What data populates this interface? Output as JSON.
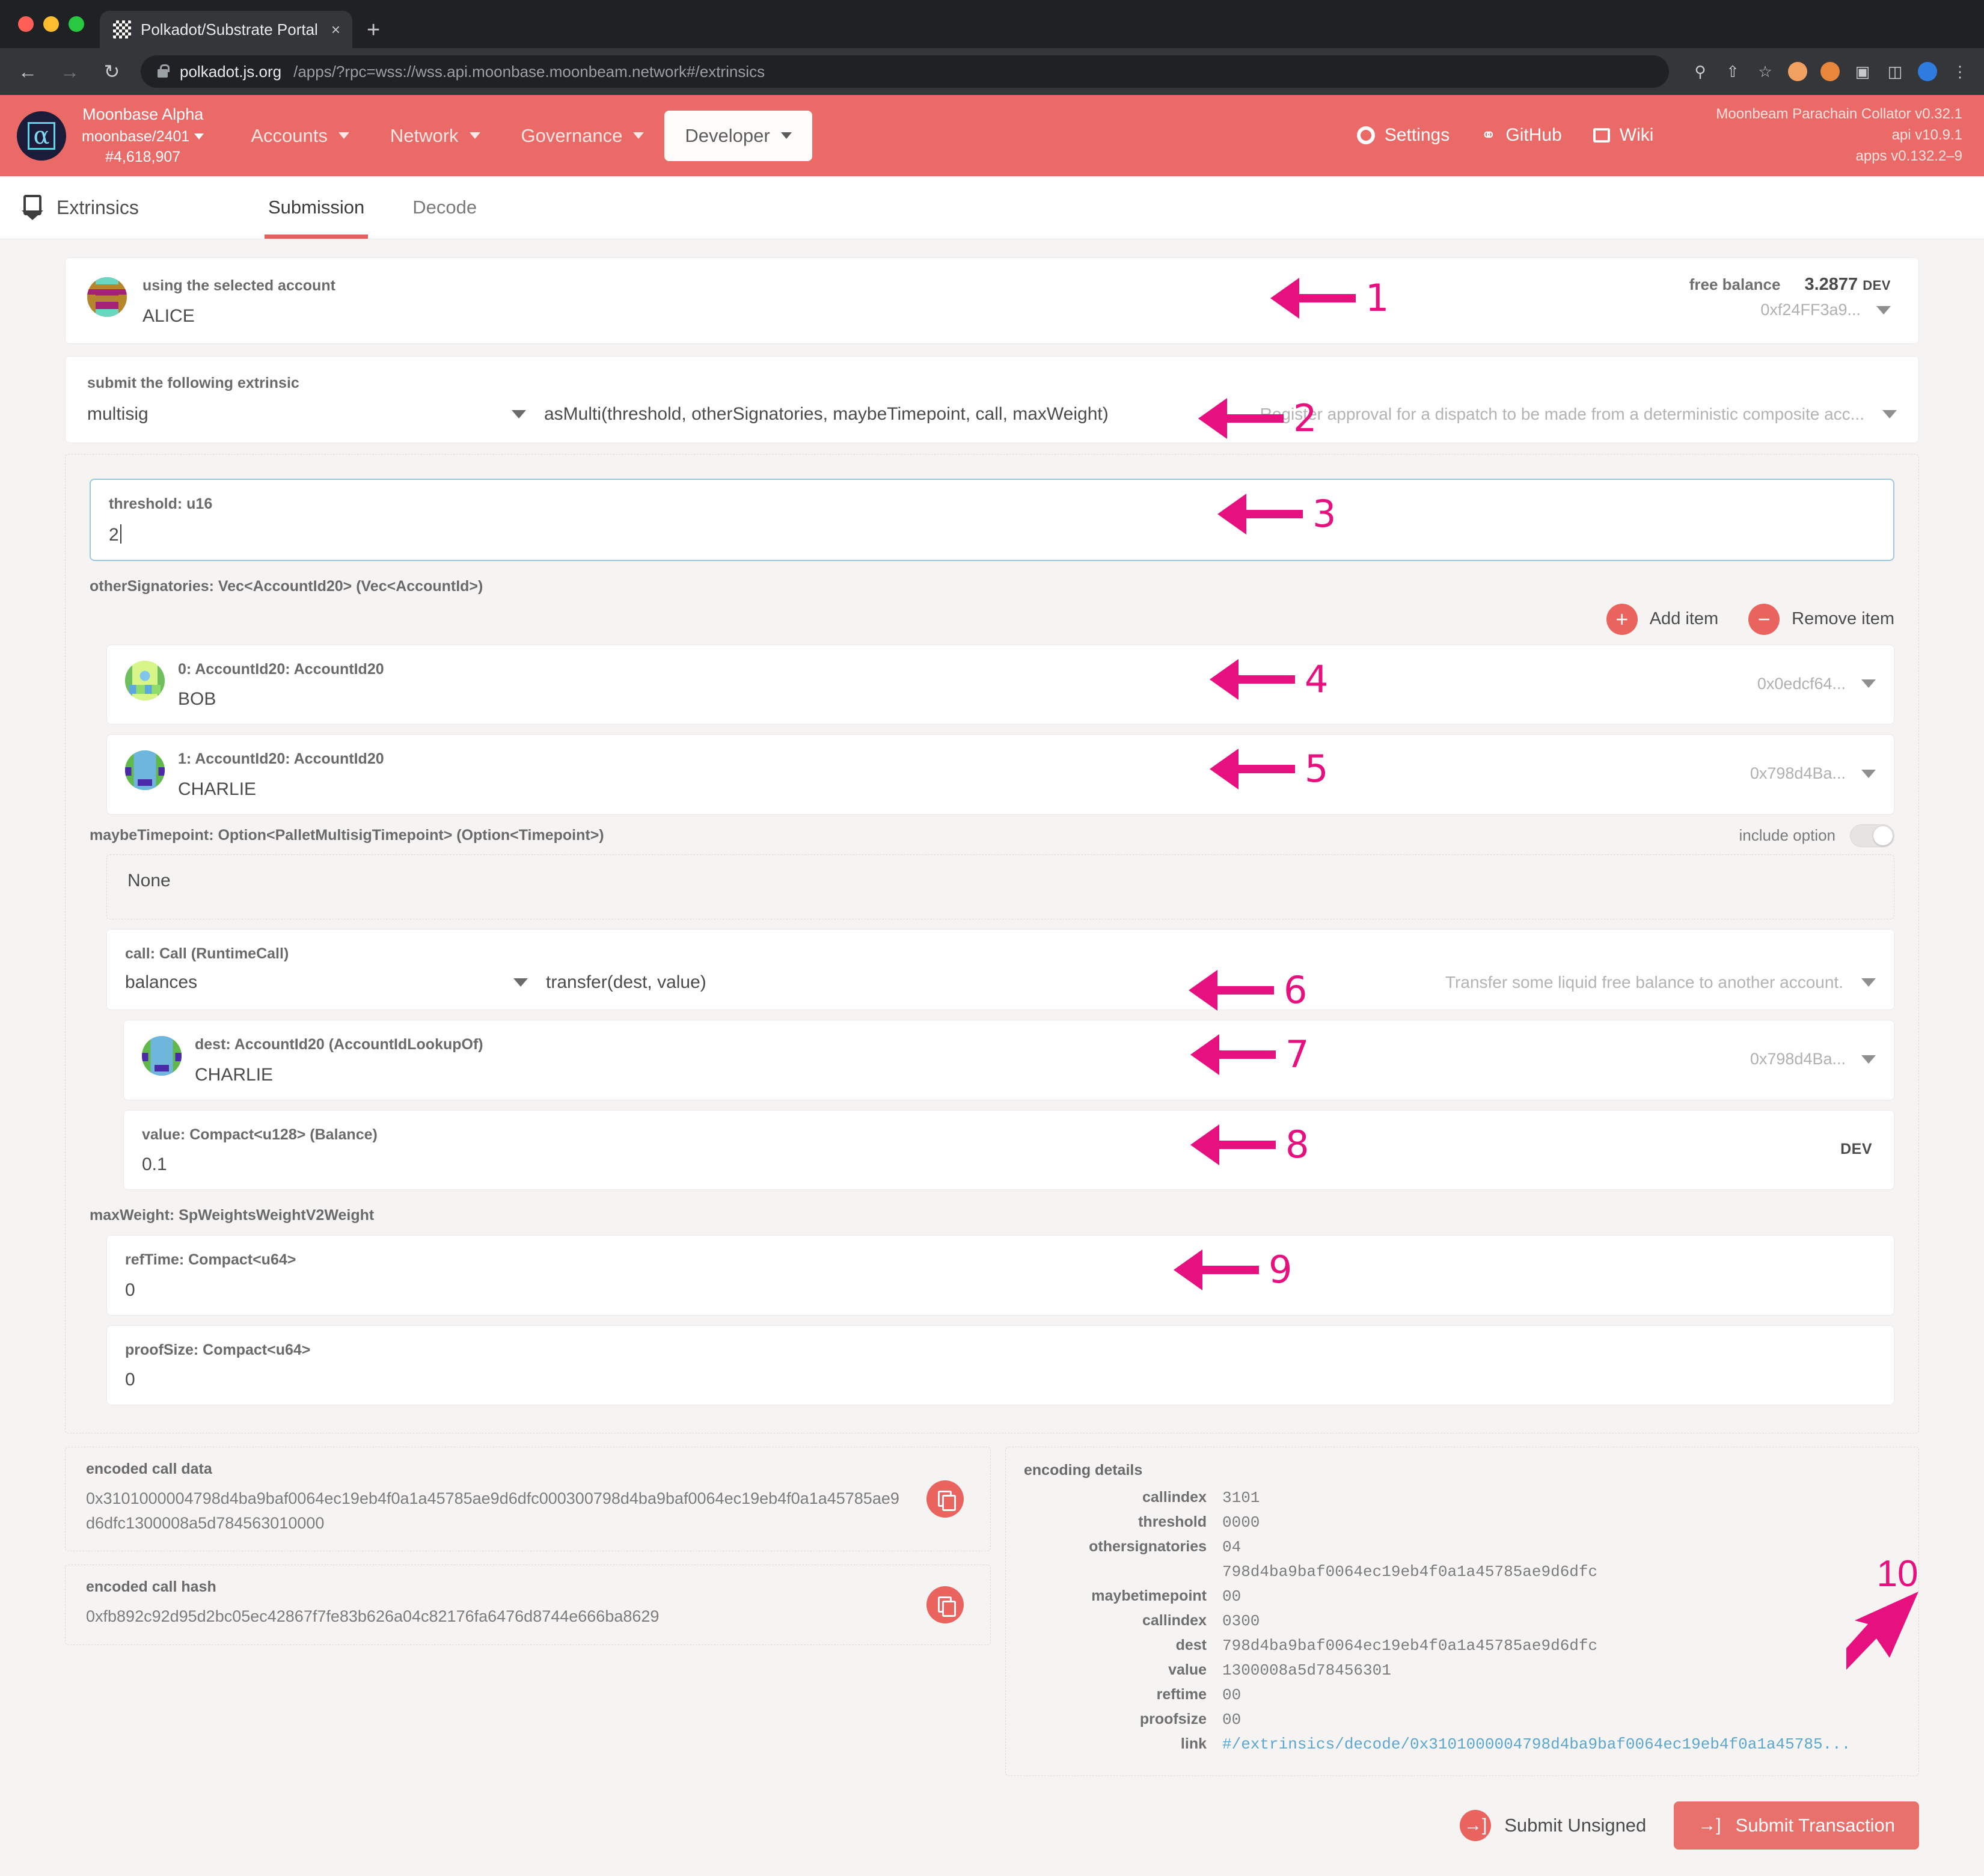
{
  "browser": {
    "tab_title": "Polkadot/Substrate Portal",
    "close_label": "×",
    "newtab_label": "+",
    "back_icon": "←",
    "forward_icon": "→",
    "reload_icon": "↻",
    "url_domain": "polkadot.js.org",
    "url_rest": "/apps/?rpc=wss://wss.api.moonbase.moonbeam.network#/extrinsics",
    "omni_icons": [
      "zoom-icon",
      "share-icon",
      "bookmark-icon",
      "extension-orange",
      "extension-fox",
      "puzzle-icon",
      "sidepanel-icon",
      "profile-icon",
      "menu-icon"
    ]
  },
  "appbar": {
    "chain_name": "Moonbase Alpha",
    "chain_spec": "moonbase/2401",
    "block_number": "#4,618,907",
    "nav": [
      {
        "label": "Accounts",
        "active": false
      },
      {
        "label": "Network",
        "active": false
      },
      {
        "label": "Governance",
        "active": false
      },
      {
        "label": "Developer",
        "active": true
      }
    ],
    "settings_label": "Settings",
    "github_label": "GitHub",
    "wiki_label": "Wiki",
    "version_node": "Moonbeam Parachain Collator v0.32.1",
    "version_api": "api v10.9.1",
    "version_apps": "apps v0.132.2–9",
    "accent": "#e96a66"
  },
  "subheader": {
    "breadcrumb": "Extrinsics",
    "tabs": [
      {
        "label": "Submission",
        "active": true
      },
      {
        "label": "Decode",
        "active": false
      }
    ]
  },
  "account": {
    "label": "using the selected account",
    "value": "ALICE",
    "balance_label": "free balance",
    "balance_amount": "3.2877",
    "balance_unit": "DEV",
    "address_short": "0xf24FF3a9..."
  },
  "extrinsic": {
    "label": "submit the following extrinsic",
    "section": "multisig",
    "method": "asMulti(threshold, otherSignatories, maybeTimepoint, call, maxWeight)",
    "docs": "Register approval for a dispatch to be made from a deterministic composite acc..."
  },
  "params": {
    "threshold": {
      "label": "threshold: u16",
      "value": "2"
    },
    "otherSignatories": {
      "label": "otherSignatories: Vec<AccountId20> (Vec<AccountId>)",
      "add_label": "Add item",
      "remove_label": "Remove item",
      "add_icon": "+",
      "remove_icon": "−",
      "items": [
        {
          "label": "0: AccountId20: AccountId20",
          "value": "BOB",
          "address_short": "0x0edcf64..."
        },
        {
          "label": "1: AccountId20: AccountId20",
          "value": "CHARLIE",
          "address_short": "0x798d4Ba..."
        }
      ]
    },
    "maybeTimepoint": {
      "label": "maybeTimepoint: Option<PalletMultisigTimepoint> (Option<Timepoint>)",
      "toggle_label": "include option",
      "toggle_on": false,
      "value": "None"
    },
    "call": {
      "label": "call: Call (RuntimeCall)",
      "section": "balances",
      "method": "transfer(dest, value)",
      "docs": "Transfer some liquid free balance to another account.",
      "dest": {
        "label": "dest: AccountId20 (AccountIdLookupOf)",
        "value": "CHARLIE",
        "address_short": "0x798d4Ba..."
      },
      "value": {
        "label": "value: Compact<u128> (Balance)",
        "value": "0.1",
        "unit": "DEV"
      }
    },
    "maxWeight": {
      "label": "maxWeight: SpWeightsWeightV2Weight",
      "refTime": {
        "label": "refTime: Compact<u64>",
        "value": "0"
      },
      "proofSize": {
        "label": "proofSize: Compact<u64>",
        "value": "0"
      }
    }
  },
  "encoded": {
    "call_data_label": "encoded call data",
    "call_data": "0x3101000004798d4ba9baf0064ec19eb4f0a1a45785ae9d6dfc000300798d4ba9baf0064ec19eb4f0a1a45785ae9d6dfc1300008a5d784563010000",
    "call_hash_label": "encoded call hash",
    "call_hash": "0xfb892c92d95d2bc05ec42867f7fe83b626a04c82176fa6476d8744e666ba8629",
    "copy_icon": "copy-icon"
  },
  "encoding_details": {
    "title": "encoding details",
    "rows": [
      {
        "key": "callindex",
        "value": "3101"
      },
      {
        "key": "threshold",
        "value": "0000"
      },
      {
        "key": "othersignatories",
        "value": "04"
      },
      {
        "key": "",
        "value": "798d4ba9baf0064ec19eb4f0a1a45785ae9d6dfc"
      },
      {
        "key": "maybetimepoint",
        "value": "00"
      },
      {
        "key": "callindex",
        "value": "0300"
      },
      {
        "key": "dest",
        "value": "798d4ba9baf0064ec19eb4f0a1a45785ae9d6dfc"
      },
      {
        "key": "value",
        "value": "1300008a5d78456301"
      },
      {
        "key": "reftime",
        "value": "00"
      },
      {
        "key": "proofsize",
        "value": "00"
      },
      {
        "key": "link",
        "value": "#/extrinsics/decode/0x3101000004798d4ba9baf0064ec19eb4f0a1a45785...",
        "is_link": true
      }
    ]
  },
  "footer": {
    "submit_unsigned": "Submit Unsigned",
    "submit_transaction": "Submit Transaction",
    "submit_icon": "→]"
  },
  "annotations": [
    {
      "n": "1"
    },
    {
      "n": "2"
    },
    {
      "n": "3"
    },
    {
      "n": "4"
    },
    {
      "n": "5"
    },
    {
      "n": "6"
    },
    {
      "n": "7"
    },
    {
      "n": "8"
    },
    {
      "n": "9"
    },
    {
      "n": "10"
    }
  ],
  "annotation_color": "#e6117f"
}
